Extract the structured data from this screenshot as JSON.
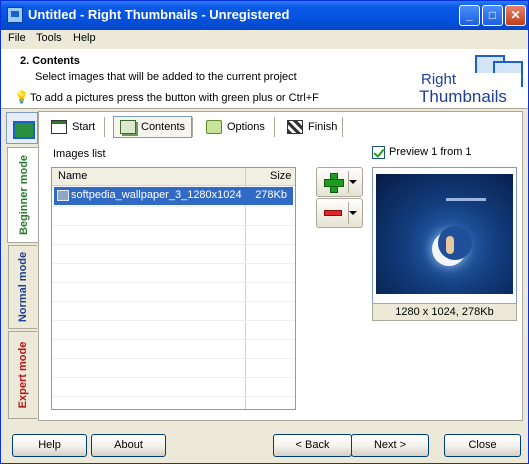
{
  "window": {
    "title": "Untitled - Right Thumbnails - Unregistered",
    "min_glyph": "_",
    "max_glyph": "□",
    "close_glyph": "✕"
  },
  "menu": [
    "File",
    "Tools",
    "Help"
  ],
  "header": {
    "step_title": "2. Contents",
    "step_desc": "Select images that will be added to the current project",
    "hint": "To add a pictures press the button with green plus or Ctrl+F",
    "logo_line1": "Right",
    "logo_line2": "Thumbnails"
  },
  "modes": {
    "beginner": "Beginner mode",
    "normal": "Normal mode",
    "expert": "Expert mode"
  },
  "mode_colors": {
    "beginner": "#2C7A2C",
    "normal": "#1D3F96",
    "expert": "#B8151B"
  },
  "toolbar": {
    "start": "Start",
    "contents": "Contents",
    "options": "Options",
    "finish": "Finish"
  },
  "images_list": {
    "label": "Images list",
    "col_name": "Name",
    "col_size": "Size",
    "rows": [
      {
        "name": "softpedia_wallpaper_3_1280x1024",
        "size": "278Kb"
      }
    ]
  },
  "preview": {
    "label": "Preview 1 from 1",
    "checked": true,
    "caption": "1280 x 1024, 278Kb"
  },
  "buttons": {
    "help": "Help",
    "about": "About",
    "back": "< Back",
    "next": "Next >",
    "close": "Close"
  }
}
